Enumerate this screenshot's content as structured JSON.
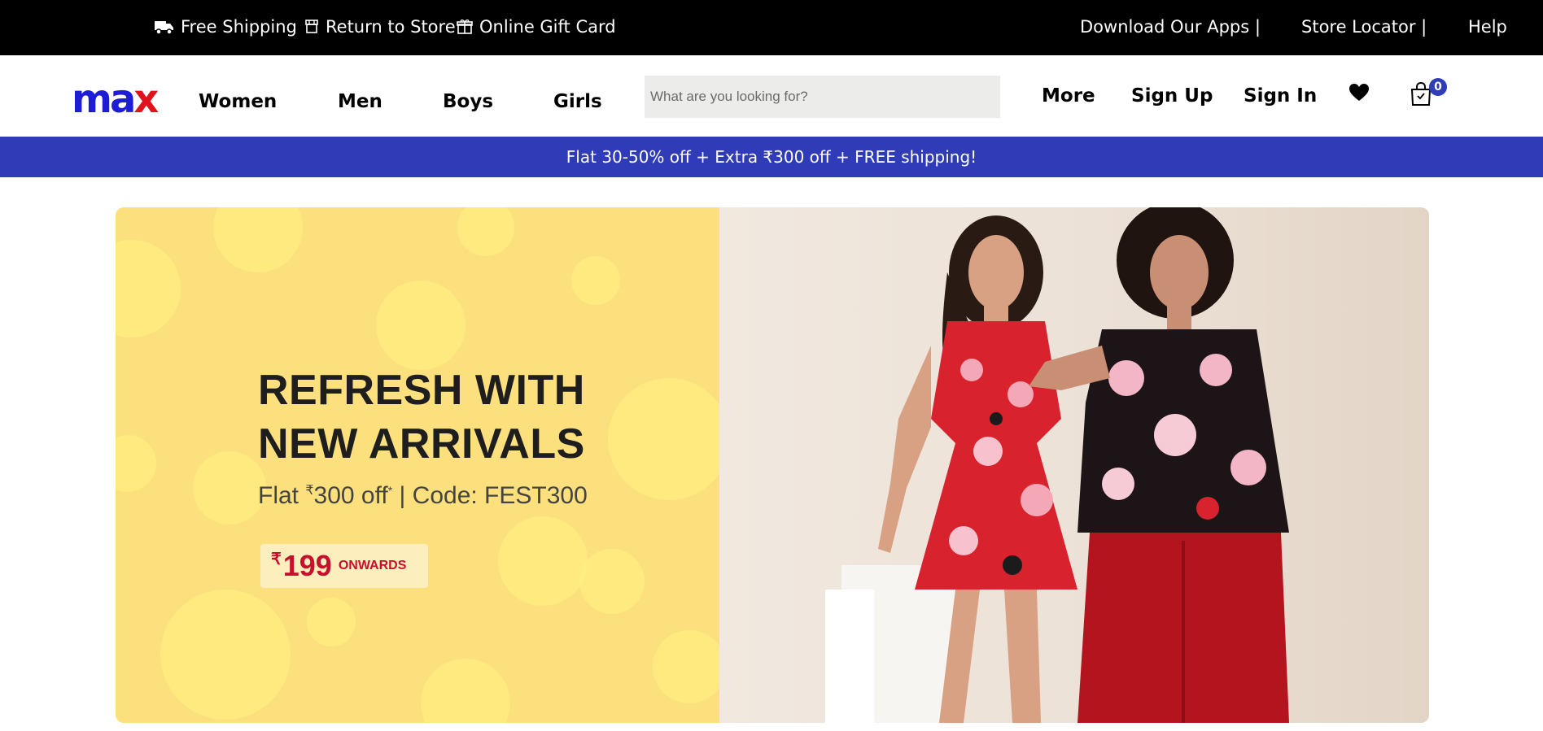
{
  "topbar": {
    "free_shipping": "Free Shipping",
    "return_to_store": "Return to Store",
    "gift_card": "Online Gift Card",
    "download_apps": "Download Our Apps |",
    "store_locator": "Store Locator |",
    "help": "Help"
  },
  "header": {
    "logo": {
      "m": "m",
      "a": "a",
      "x": "x"
    },
    "nav": [
      "Women",
      "Men",
      "Boys",
      "Girls"
    ],
    "search_placeholder": "What are you looking for?",
    "more": "More",
    "sign_up": "Sign Up",
    "sign_in": "Sign In",
    "cart_count": "0"
  },
  "promo": {
    "text": "Flat 30-50% off + Extra ₹300 off + FREE shipping!"
  },
  "hero": {
    "headline_line1": "REFRESH WITH",
    "headline_line2": "NEW ARRIVALS",
    "offer_prefix": "Flat ",
    "offer_currency": "₹",
    "offer_amount": "300 off",
    "offer_asterisk": "*",
    "offer_code": " | Code: FEST300",
    "price_currency": "₹",
    "price_amount": "199",
    "price_suffix": "ONWARDS"
  },
  "colors": {
    "topbar_bg": "#000000",
    "brand_blue": "#1d1dd8",
    "brand_red": "#e1121c",
    "promo_bg": "#303bb8",
    "hero_left_bg": "#fde07e",
    "price_red": "#c8102e"
  },
  "icons": [
    "truck-icon",
    "store-icon",
    "gift-icon",
    "heart-icon",
    "shopping-bag-icon"
  ]
}
